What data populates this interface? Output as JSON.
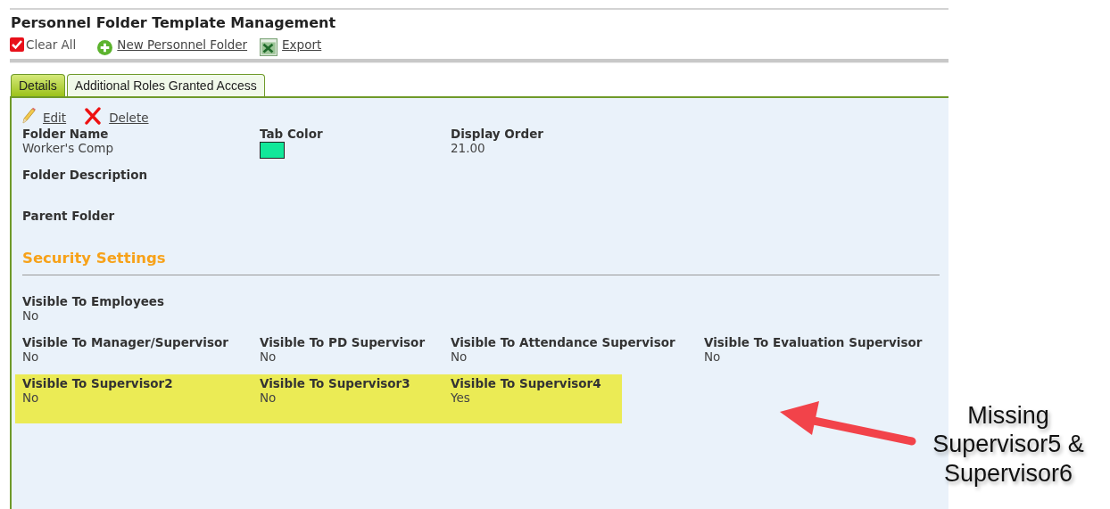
{
  "page_title": "Personnel Folder Template Management",
  "toolbar": [
    {
      "label": "Clear All",
      "kind": "check"
    },
    {
      "label": "New Personnel Folder",
      "kind": "add"
    },
    {
      "label": "Export",
      "kind": "excel"
    }
  ],
  "tabs": [
    {
      "label": "Details",
      "selected": true
    },
    {
      "label": "Additional Roles Granted Access",
      "selected": false
    }
  ],
  "actions": [
    {
      "label": "Edit",
      "kind": "edit"
    },
    {
      "label": "Delete",
      "kind": "delete"
    }
  ],
  "sections": [
    {
      "rows": [
        {
          "highlighted": false,
          "fields": [
            {
              "label": "Folder Name",
              "kind": "text",
              "value": "Worker's Comp"
            },
            {
              "label": "Tab Color",
              "kind": "swatch",
              "color": "#11e899"
            },
            {
              "label": "Display Order",
              "kind": "text",
              "value": "21.00"
            }
          ]
        },
        {
          "highlighted": false,
          "fields": [
            {
              "label": "Folder Description",
              "kind": "text"
            }
          ]
        },
        {
          "highlighted": false,
          "fields": [
            {
              "label": "Parent Folder",
              "kind": "text"
            }
          ]
        }
      ]
    },
    {
      "heading": "Security Settings",
      "rows": [
        {
          "highlighted": false,
          "fields": [
            {
              "label": "Visible To Employees",
              "kind": "text",
              "value": "No"
            }
          ]
        },
        {
          "highlighted": false,
          "fields": [
            {
              "label": "Visible To Manager/Supervisor",
              "kind": "text",
              "value": "No"
            },
            {
              "label": "Visible To PD Supervisor",
              "kind": "text",
              "value": "No"
            },
            {
              "label": "Visible To Attendance Supervisor",
              "kind": "text",
              "value": "No"
            },
            {
              "label": "Visible To Evaluation Supervisor",
              "kind": "text",
              "value": "No"
            }
          ]
        },
        {
          "highlighted": true,
          "fields": [
            {
              "label": "Visible To Supervisor2",
              "kind": "text",
              "value": "No"
            },
            {
              "label": "Visible To Supervisor3",
              "kind": "text",
              "value": "No"
            },
            {
              "label": "Visible To Supervisor4",
              "kind": "text",
              "value": "Yes"
            }
          ]
        }
      ]
    }
  ],
  "annotation": {
    "text": "Missing Supervisor5 & Supervisor6"
  }
}
